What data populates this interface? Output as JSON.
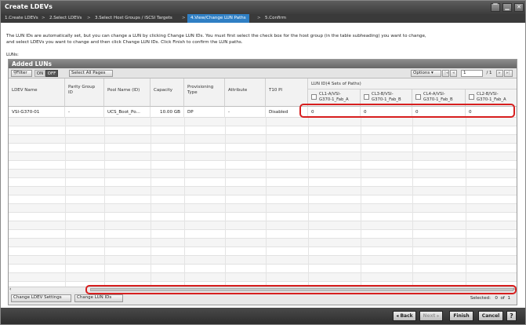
{
  "window": {
    "title": "Create LDEVs"
  },
  "steps": [
    {
      "label": "1.Create LDEVs"
    },
    {
      "label": "2.Select LDEVs"
    },
    {
      "label": "3.Select Host Groups / iSCSI Targets"
    },
    {
      "label": "4.View/Change LUN Paths",
      "active": true
    },
    {
      "label": "5.Confirm"
    }
  ],
  "description": {
    "line1": "The LUN IDs are automatically set, but you can change a LUN by clicking Change LUN IDs. You must first select the check box for the host group (in the table subheading) you want to change,",
    "line2": "and select LDEVs you want to change and then click Change LUN IDs. Click Finish to confirm the LUN paths."
  },
  "luns_label": "LUNs:",
  "panel": {
    "title": "Added LUNs"
  },
  "toolbar": {
    "filter": "Filter",
    "on": "ON",
    "off": "OFF",
    "select_all": "Select All Pages",
    "options": "Options",
    "page_current": "1",
    "page_total": "/ 1"
  },
  "table": {
    "columns": {
      "ldev_name": "LDEV Name",
      "parity_group_id": "Parity Group ID",
      "pool_name": "Pool Name (ID)",
      "capacity": "Capacity",
      "provisioning_type": "Provisioning Type",
      "attribute": "Attribute",
      "t10_pi": "T10 PI"
    },
    "lun_group": "LUN ID(4 Sets of Paths)",
    "lun_paths": [
      {
        "line1": "CL1-A/VSI-",
        "line2": "G370-1_Fab_A"
      },
      {
        "line1": "CL3-B/VSI-",
        "line2": "G370-1_Fab_B"
      },
      {
        "line1": "CL4-A/VSI-",
        "line2": "G370-1_Fab_B"
      },
      {
        "line1": "CL2-B/VSI-",
        "line2": "G370-1_Fab_A"
      }
    ],
    "rows": [
      {
        "ldev_name": "VSI-G370-01",
        "parity_group_id": "-",
        "pool_name": "UCS_Boot_Po...",
        "capacity": "10.00 GB",
        "provisioning_type": "DP",
        "attribute": "-",
        "t10_pi": "Disabled",
        "lun_ids": [
          "0",
          "0",
          "0",
          "0"
        ]
      }
    ]
  },
  "bottom": {
    "change_ldev_settings": "Change LDEV Settings",
    "change_lun_ids": "Change LUN IDs",
    "selected_label": "Selected:",
    "selected_count": "0",
    "selected_of": "of",
    "selected_total": "1"
  },
  "footer": {
    "back": "◂ Back",
    "next": "Next ▸",
    "finish": "Finish",
    "cancel": "Cancel",
    "help": "?"
  },
  "colors": {
    "highlight": "#d71f1f",
    "active_step": "#2f7fc4"
  }
}
